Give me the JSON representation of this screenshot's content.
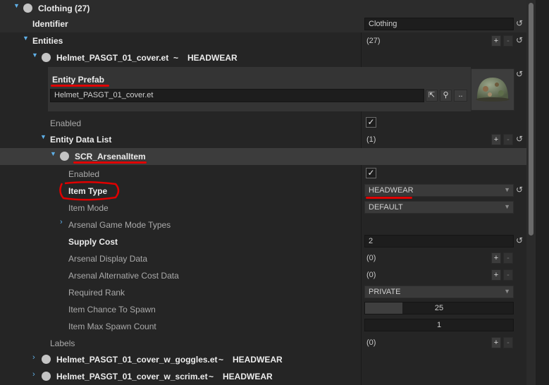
{
  "tree": {
    "clothing": {
      "label": "Clothing (27)"
    },
    "identifier": {
      "label": "Identifier",
      "value": "Clothing"
    },
    "entities": {
      "label": "Entities",
      "value": "(27)"
    },
    "helmet": {
      "name": "Helmet_PASGT_01_cover.et",
      "sep": "~",
      "type": "HEADWEAR"
    },
    "prefab": {
      "label": "Entity Prefab",
      "value": "Helmet_PASGT_01_cover.et",
      "browse": ".."
    },
    "enabled": {
      "label": "Enabled",
      "checked": true
    },
    "entity_data_list": {
      "label": "Entity Data List",
      "value": "(1)"
    },
    "arsenal_item": {
      "label": "SCR_ArsenalItem"
    },
    "props": {
      "enabled": {
        "label": "Enabled",
        "checked": true
      },
      "item_type": {
        "label": "Item Type",
        "value": "HEADWEAR"
      },
      "item_mode": {
        "label": "Item Mode",
        "value": "DEFAULT"
      },
      "game_mode_types": {
        "label": "Arsenal Game Mode Types"
      },
      "supply_cost": {
        "label": "Supply Cost",
        "value": "2"
      },
      "display_data": {
        "label": "Arsenal Display Data",
        "value": "(0)"
      },
      "alt_cost": {
        "label": "Arsenal Alternative Cost Data",
        "value": "(0)"
      },
      "required_rank": {
        "label": "Required Rank",
        "value": "PRIVATE"
      },
      "chance_to_spawn": {
        "label": "Item Chance To Spawn",
        "value": "25",
        "level": 0.25
      },
      "max_spawn": {
        "label": "Item Max Spawn Count",
        "value": "1"
      }
    },
    "labels": {
      "label": "Labels",
      "value": "(0)"
    },
    "goggles": {
      "name": "Helmet_PASGT_01_cover_w_goggles.et",
      "sep": "~",
      "type": "HEADWEAR"
    },
    "scrim": {
      "name": "Helmet_PASGT_01_cover_w_scrim.et",
      "sep": "~",
      "type": "HEADWEAR"
    }
  },
  "buttons": {
    "plus": "+",
    "minus": "-"
  },
  "colors": {
    "accent": "#5fb0e8",
    "annotation": "#e00000",
    "background": "#252525"
  }
}
